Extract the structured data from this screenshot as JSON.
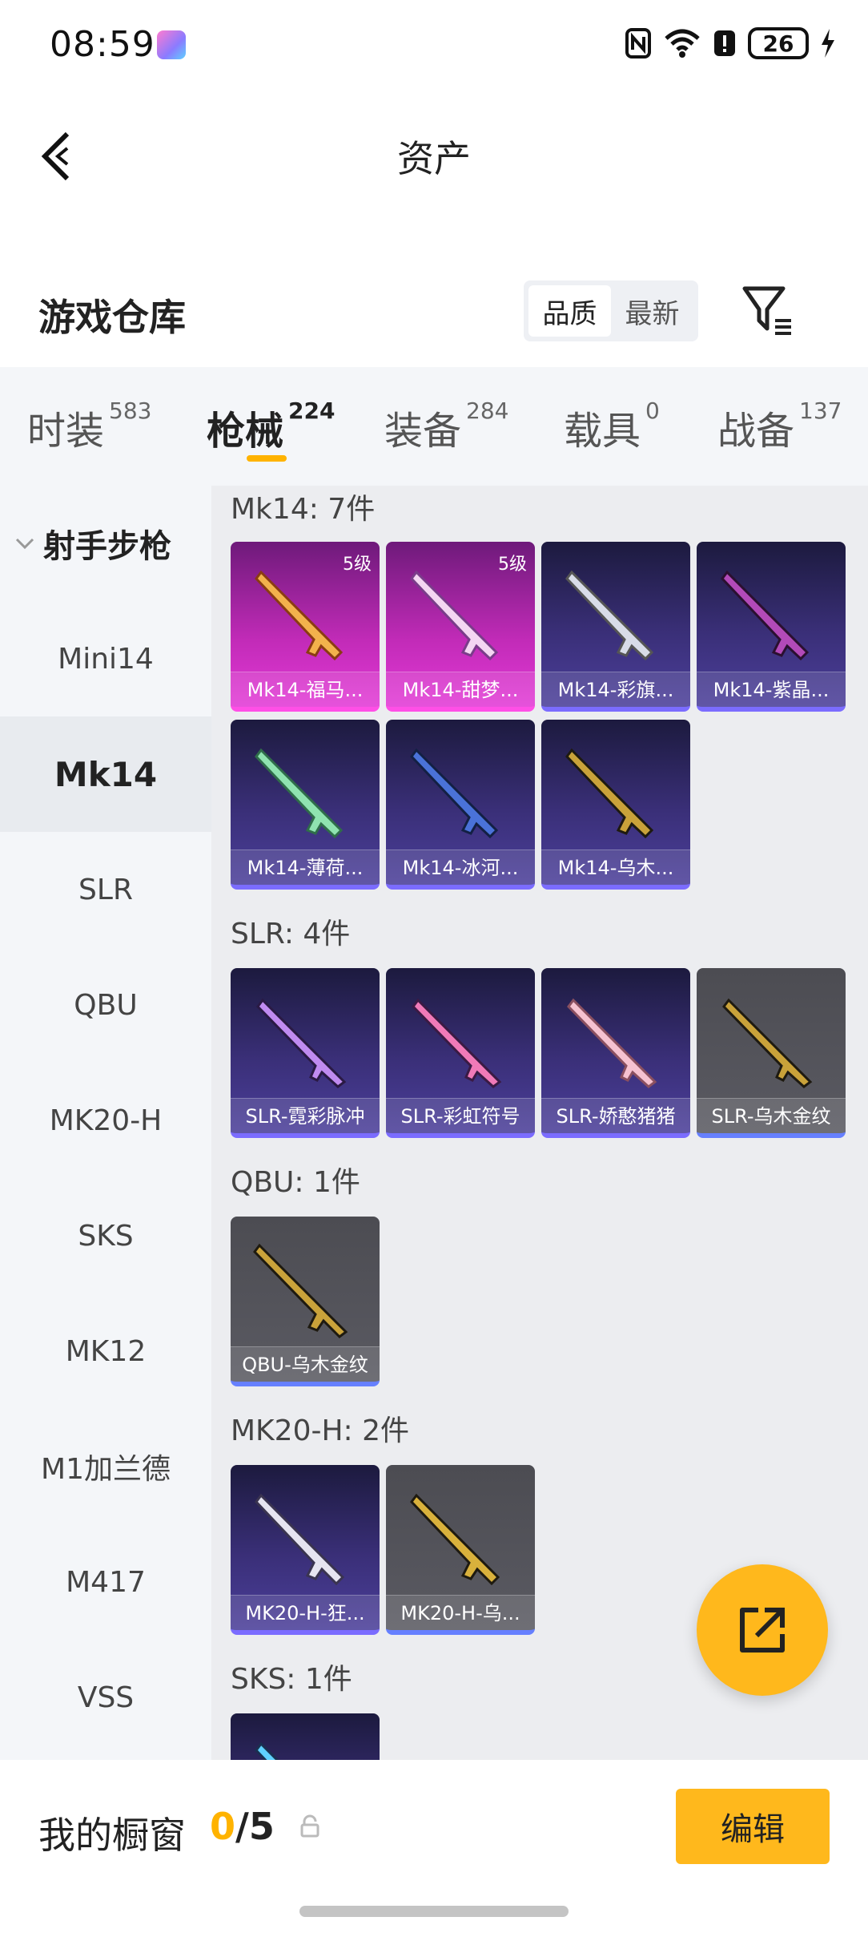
{
  "status_bar": {
    "time": "08:59",
    "battery": "26"
  },
  "header": {
    "title": "资产"
  },
  "warehouse": {
    "title": "游戏仓库",
    "sort_options": [
      "品质",
      "最新"
    ],
    "active_sort": "品质"
  },
  "tabs": [
    {
      "label": "时装",
      "count": "583"
    },
    {
      "label": "枪械",
      "count": "224"
    },
    {
      "label": "装备",
      "count": "284"
    },
    {
      "label": "载具",
      "count": "0"
    },
    {
      "label": "战备",
      "count": "137"
    }
  ],
  "active_tab": "枪械",
  "sidebar": {
    "group": "射手步枪",
    "items": [
      "Mini14",
      "Mk14",
      "SLR",
      "QBU",
      "MK20-H",
      "SKS",
      "MK12",
      "M1加兰德",
      "M417",
      "VSS"
    ],
    "active": "Mk14"
  },
  "sections": [
    {
      "heading": "Mk14: 7件",
      "items": [
        {
          "label": "Mk14-福马...",
          "level": "5级",
          "style": "pink"
        },
        {
          "label": "Mk14-甜梦...",
          "level": "5级",
          "style": "pink"
        },
        {
          "label": "Mk14-彩旗...",
          "style": "purple"
        },
        {
          "label": "Mk14-紫晶...",
          "style": "purple"
        },
        {
          "label": "Mk14-薄荷...",
          "style": "purple"
        },
        {
          "label": "Mk14-冰河...",
          "style": "purple"
        },
        {
          "label": "Mk14-乌木...",
          "style": "purple"
        }
      ]
    },
    {
      "heading": "SLR: 4件",
      "items": [
        {
          "label": "SLR-霓彩脉冲",
          "style": "purple"
        },
        {
          "label": "SLR-彩虹符号",
          "style": "purple"
        },
        {
          "label": "SLR-娇憨猪猪",
          "style": "purple"
        },
        {
          "label": "SLR-乌木金纹",
          "style": "gray"
        }
      ]
    },
    {
      "heading": "QBU: 1件",
      "items": [
        {
          "label": "QBU-乌木金纹",
          "style": "gray"
        }
      ]
    },
    {
      "heading": "MK20-H: 2件",
      "items": [
        {
          "label": "MK20-H-狂...",
          "style": "purple"
        },
        {
          "label": "MK20-H-乌...",
          "style": "gray"
        }
      ]
    },
    {
      "heading": "SKS: 1件",
      "items": [
        {
          "label": "",
          "style": "purple"
        }
      ]
    }
  ],
  "bottom_bar": {
    "label": "我的橱窗",
    "current": "0",
    "total": "/5",
    "edit_label": "编辑"
  },
  "colors": {
    "accent": "#ffb81c",
    "purple_card": "#3a2f78",
    "pink_card": "#c22bb8",
    "gray_card": "#55555c"
  }
}
